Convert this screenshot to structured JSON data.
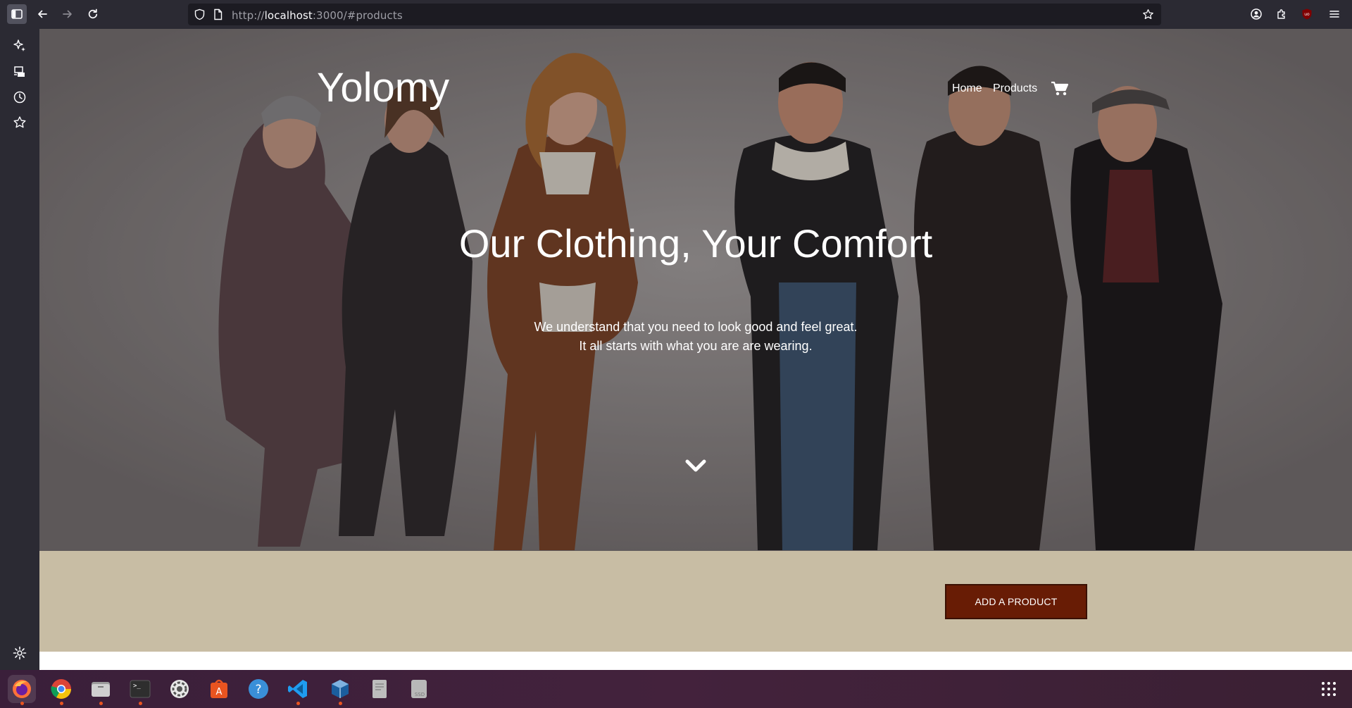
{
  "browser": {
    "url_prefix": "http://",
    "url_host": "localhost",
    "url_rest": ":3000/#products"
  },
  "site": {
    "logo": "Yolomy",
    "nav": {
      "home": "Home",
      "products": "Products"
    },
    "hero": {
      "headline": "Our Clothing, Your Comfort",
      "subline_1": "We understand that you need to look good and feel great.",
      "subline_2": "It all starts with what you are are wearing."
    },
    "add_product_label": "ADD A PRODUCT"
  },
  "colors": {
    "band": "#c8bda4",
    "button": "#681c05"
  },
  "sidebar": {
    "icons": [
      "ai-chatbot-icon",
      "synced-tabs-icon",
      "history-icon",
      "bookmarks-icon",
      "settings-icon"
    ]
  },
  "taskbar": {
    "apps": [
      "firefox-icon",
      "chrome-icon",
      "files-icon",
      "terminal-icon",
      "settings-icon",
      "app-center-icon",
      "help-icon",
      "vscode-icon",
      "virtualbox-icon",
      "text-file-icon",
      "ssd-drive-icon",
      "show-apps-icon"
    ]
  }
}
